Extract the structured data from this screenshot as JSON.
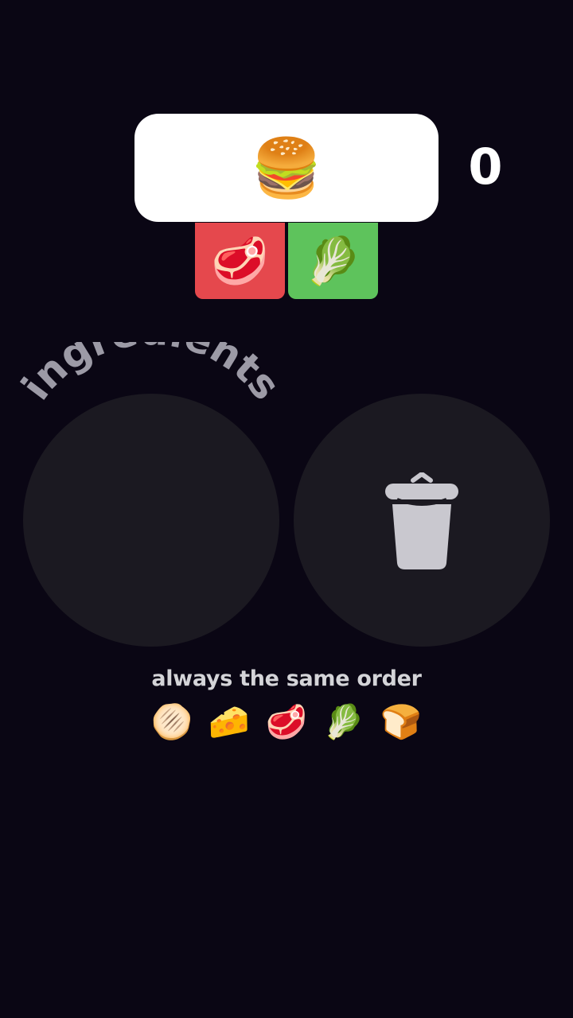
{
  "order": {
    "icon": "burger-icon",
    "emoji": "🍔"
  },
  "score": "0",
  "slots": [
    {
      "icon": "steak-icon",
      "emoji": "🥩",
      "color": "#e5484d"
    },
    {
      "icon": "lettuce-icon",
      "emoji": "🥬",
      "color": "#5ec35c"
    }
  ],
  "ingredients_label": "ingredients",
  "trash": {
    "icon": "trash-icon"
  },
  "hint": "always the same order",
  "sequence": [
    {
      "icon": "bun-bottom-icon",
      "emoji": "🫓"
    },
    {
      "icon": "cheese-icon",
      "emoji": "🧀"
    },
    {
      "icon": "steak-icon",
      "emoji": "🥩"
    },
    {
      "icon": "lettuce-icon",
      "emoji": "🥬"
    },
    {
      "icon": "bun-top-icon",
      "emoji": "🍞"
    }
  ],
  "colors": {
    "background": "#0a0614",
    "panel": "#1b1921",
    "card": "#ffffff",
    "label": "#9c9aa6"
  }
}
